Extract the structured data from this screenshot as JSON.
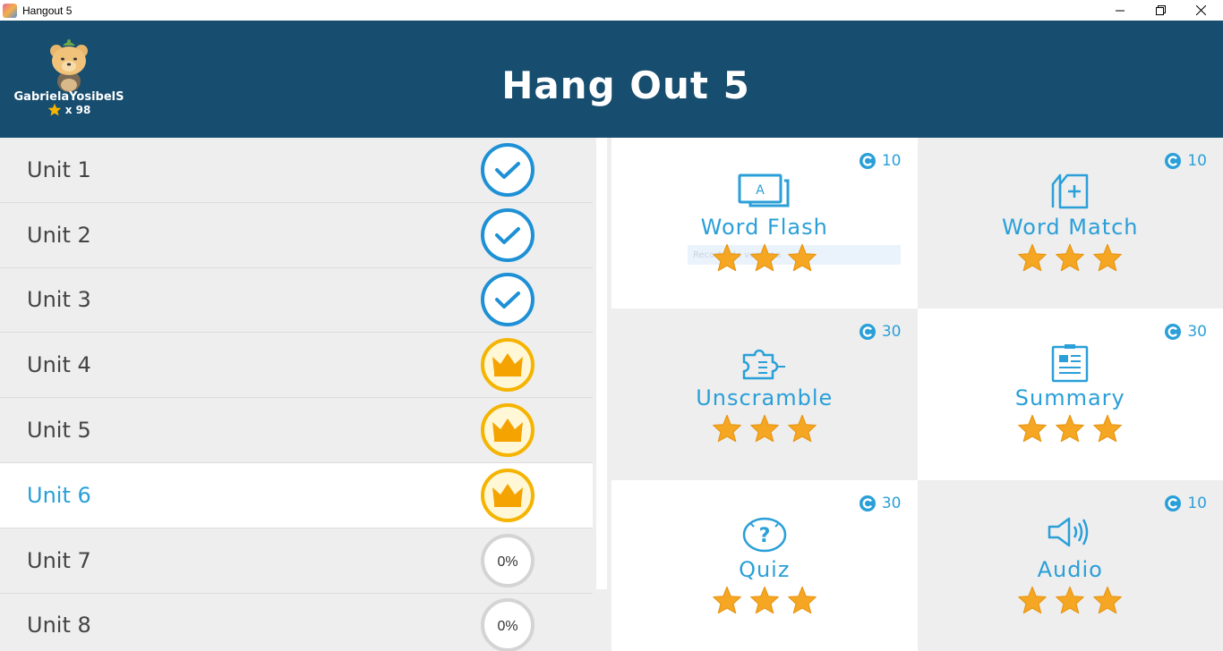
{
  "window": {
    "title": "Hangout 5",
    "icon": "app-icon"
  },
  "header": {
    "title": "Hang Out 5",
    "username": "GabrielaYosibelS",
    "star_count": "x  98"
  },
  "units": [
    {
      "label": "Unit 1",
      "status": "complete"
    },
    {
      "label": "Unit 2",
      "status": "complete"
    },
    {
      "label": "Unit 3",
      "status": "complete"
    },
    {
      "label": "Unit 4",
      "status": "crown"
    },
    {
      "label": "Unit 5",
      "status": "crown"
    },
    {
      "label": "Unit 6",
      "status": "crown",
      "active": true
    },
    {
      "label": "Unit 7",
      "status": "progress",
      "percent": "0%"
    },
    {
      "label": "Unit 8",
      "status": "progress",
      "percent": "0%"
    }
  ],
  "activities": [
    {
      "title": "Word Flash",
      "coins": "10",
      "icon": "word-flash-icon",
      "stars": 3,
      "hint": "Recorte de ventana"
    },
    {
      "title": "Word Match",
      "coins": "10",
      "icon": "word-match-icon",
      "stars": 3
    },
    {
      "title": "Unscramble",
      "coins": "30",
      "icon": "puzzle-icon",
      "stars": 3
    },
    {
      "title": "Summary",
      "coins": "30",
      "icon": "summary-icon",
      "stars": 3
    },
    {
      "title": "Quiz",
      "coins": "30",
      "icon": "quiz-icon",
      "stars": 3
    },
    {
      "title": "Audio",
      "coins": "10",
      "icon": "speaker-icon",
      "stars": 3
    }
  ],
  "colors": {
    "header_bg": "#174d6e",
    "accent": "#2a9fd8",
    "check_blue": "#1e90d6",
    "crown_gold": "#f5b400",
    "star_gold": "#f5a623",
    "list_bg": "#eeeeee"
  }
}
